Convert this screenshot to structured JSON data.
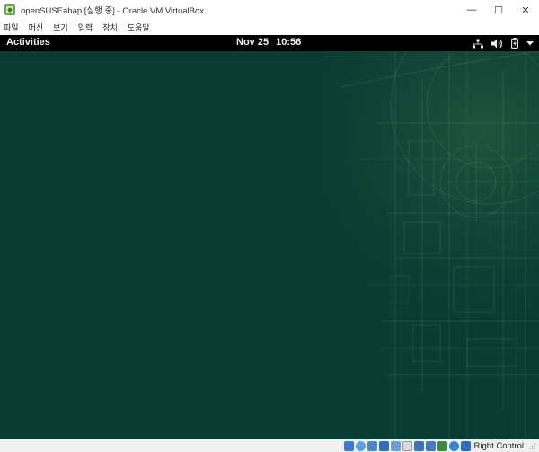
{
  "window": {
    "title": "openSUSEabap [실행 중] - Oracle VM VirtualBox",
    "app_icon": "virtualbox-icon",
    "controls": {
      "minimize": "—",
      "maximize": "☐",
      "close": "✕"
    }
  },
  "menubar": {
    "items": [
      {
        "label": "파일"
      },
      {
        "label": "머신"
      },
      {
        "label": "보기"
      },
      {
        "label": "입력"
      },
      {
        "label": "장치"
      },
      {
        "label": "도움말"
      }
    ]
  },
  "guest": {
    "panel": {
      "activities_label": "Activities",
      "date": "Nov 25",
      "time": "10:56",
      "tray_icons": [
        "network-wired-icon",
        "volume-icon",
        "battery-icon",
        "system-menu-arrow-icon"
      ]
    },
    "background_color": "#083d33"
  },
  "statusbar": {
    "icons": [
      "hard-disk-icon",
      "optical-drive-icon",
      "audio-icon",
      "network-icon",
      "usb-icon",
      "shared-folders-icon",
      "display-icon",
      "video-capture-icon",
      "virtualization-icon",
      "mouse-integration-icon",
      "keyboard-icon"
    ],
    "host_key_label": "Right Control"
  }
}
